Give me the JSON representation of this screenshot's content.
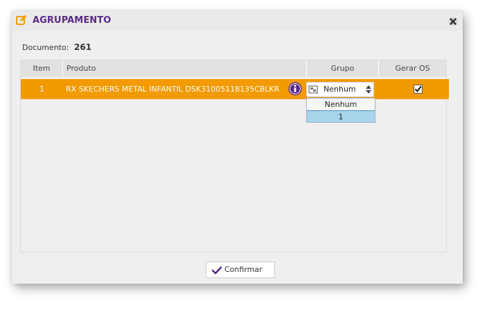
{
  "dialog": {
    "title": "AGRUPAMENTO",
    "title_icon": "edit-icon",
    "close_icon": "close-icon",
    "title_color": "#5a2a86"
  },
  "document": {
    "label": "Documento:",
    "value": "261"
  },
  "grid": {
    "columns": [
      "Item",
      "Produto",
      "Grupo",
      "Gerar OS"
    ],
    "rows": [
      {
        "item": "1",
        "produto": "RX SKECHERS METAL INFANTIL  DSK31005118135CBLKR",
        "grupo": "Nenhum",
        "gerar_os": true
      }
    ],
    "selected_row_color": "#f39a00"
  },
  "grupo_dropdown": {
    "options": [
      "Nenhum",
      "1"
    ],
    "highlighted": "1"
  },
  "footer": {
    "confirm_label": "Confirmar"
  }
}
